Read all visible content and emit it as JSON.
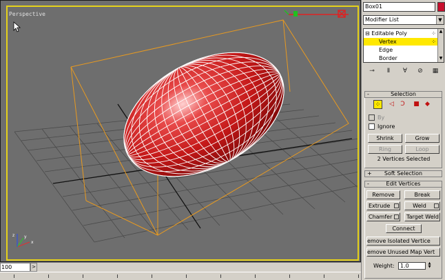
{
  "viewport": {
    "label": "Perspective",
    "frame_color": "#e6d21a",
    "object_color": "#c8102e"
  },
  "timeline": {
    "frame_value": "100",
    "arrow": ">"
  },
  "panel": {
    "object_name": "Box01",
    "object_color": "#c8102e",
    "modifier_list": "Modifier List",
    "stack": [
      {
        "label": "Editable Poly",
        "prefix": "⊟",
        "selected": false
      },
      {
        "label": "Vertex",
        "prefix": "",
        "selected": true
      },
      {
        "label": "Edge",
        "prefix": "",
        "selected": false
      },
      {
        "label": "Border",
        "prefix": "",
        "selected": false
      }
    ],
    "selection": {
      "title": "Selection",
      "sign": "-",
      "by_label": "By",
      "ignore_label": "Ignore",
      "shrink": "Shrink",
      "grow": "Grow",
      "ring": "Ring",
      "loop": "Loop",
      "status": "2 Vertices Selected"
    },
    "soft_selection": {
      "title": "Soft Selection",
      "sign": "+"
    },
    "edit_vertices": {
      "title": "Edit Vertices",
      "sign": "-",
      "remove": "Remove",
      "break": "Break",
      "extrude": "Extrude",
      "weld": "Weld",
      "chamfer": "Chamfer",
      "target_weld": "Target Weld",
      "connect": "Connect",
      "remove_isolated": "emove Isolated Vertice",
      "remove_unused": "emove Unused Map Vert",
      "weight_label": "Weight:",
      "weight_value": "1.0"
    }
  }
}
